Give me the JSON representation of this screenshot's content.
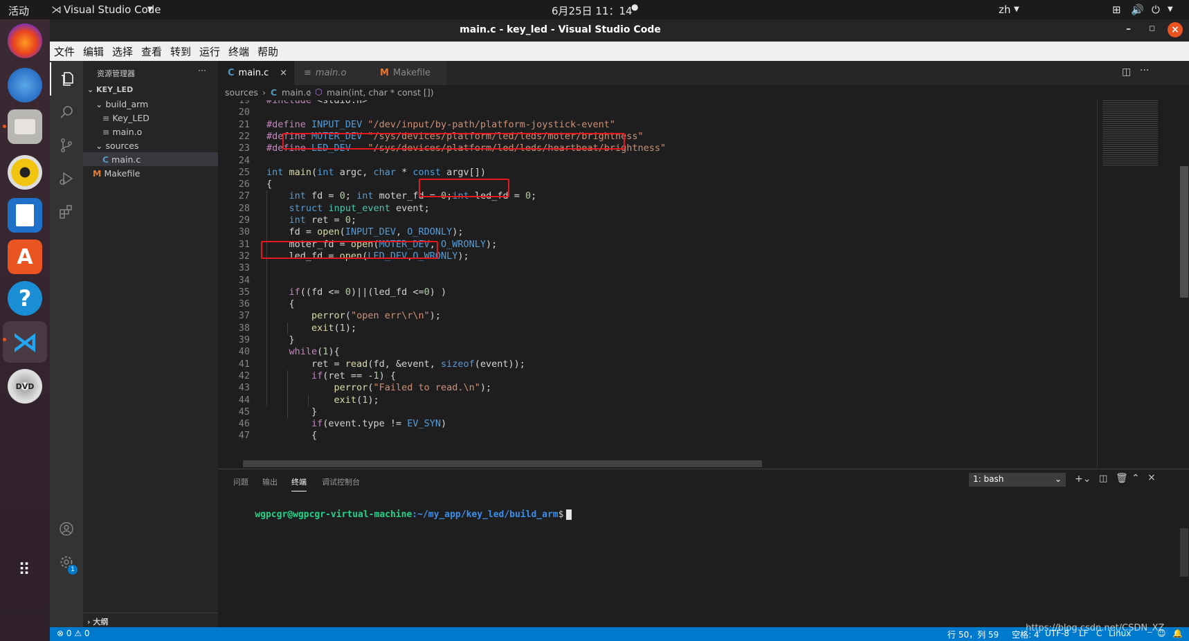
{
  "topbar": {
    "activities": "活动",
    "app_name": "Visual Studio Code",
    "clock": "6月25日  11：14",
    "lang": "zh"
  },
  "window": {
    "title": "main.c - key_led - Visual Studio Code"
  },
  "menu": [
    "文件",
    "编辑",
    "选择",
    "查看",
    "转到",
    "运行",
    "终端",
    "帮助"
  ],
  "sidebar": {
    "header": "资源管理器",
    "more": "···",
    "root": "KEY_LED",
    "items": [
      {
        "label": "build_arm",
        "icon": "v"
      },
      {
        "label": "Key_LED",
        "icon": "≡"
      },
      {
        "label": "main.o",
        "icon": "≡"
      },
      {
        "label": "sources",
        "icon": "v"
      },
      {
        "label": "main.c",
        "icon": "C"
      },
      {
        "label": "Makefile",
        "icon": "M"
      }
    ],
    "outline": "大纲"
  },
  "tabs": [
    {
      "label": "main.c",
      "icon": "C",
      "close": "×"
    },
    {
      "label": "main.o",
      "icon": "≡"
    },
    {
      "label": "Makefile",
      "icon": "M"
    }
  ],
  "breadcrumb": {
    "folder": "sources",
    "file": "main.c",
    "symbol": "main(int, char * const [])"
  },
  "editor": {
    "line_numbers": [
      "19",
      "20",
      "21",
      "22",
      "23",
      "24",
      "25",
      "26",
      "27",
      "28",
      "29",
      "30",
      "31",
      "32",
      "33",
      "34",
      "35",
      "36",
      "37",
      "38",
      "39",
      "40",
      "41",
      "42",
      "43",
      "44",
      "45",
      "46",
      "47"
    ],
    "lines": [
      "#include <stdio.h>",
      "",
      "#define INPUT_DEV \"/dev/input/by-path/platform-joystick-event\"",
      "#define MOTER_DEV \"/sys/devices/platform/led/leds/moter/brightness\"",
      "#define LED_DEV   \"/sys/devices/platform/led/leds/heartbeat/brightness\"",
      "",
      "int main(int argc, char * const argv[])",
      "{",
      "    int fd = 0; int moter_fd = 0;int led_fd = 0;",
      "    struct input_event event;",
      "    int ret = 0;",
      "    fd = open(INPUT_DEV, O_RDONLY);",
      "    moter_fd = open(MOTER_DEV, O_WRONLY);",
      "    led_fd = open(LED_DEV,O_WRONLY);",
      "",
      "",
      "    if((fd <= 0)||(led_fd <=0) )",
      "    {",
      "        perror(\"open err\\r\\n\");",
      "        exit(1);",
      "    }",
      "    while(1){",
      "        ret = read(fd, &event, sizeof(event));",
      "        if(ret == -1) {",
      "            perror(\"Failed to read.\\n\");",
      "            exit(1);",
      "        }",
      "        if(event.type != EV_SYN)",
      "        {"
    ]
  },
  "panel": {
    "tabs": [
      "问题",
      "输出",
      "终端",
      "调试控制台"
    ],
    "active_tab": "终端",
    "terminal_select": "1: bash",
    "prompt_user": "wgpcgr@wgpcgr-virtual-machine",
    "prompt_path": ":~/my_app/key_led/build_arm",
    "prompt_sign": "$"
  },
  "status": {
    "errors": "⊗ 0 ⚠ 0",
    "position": "行 50，列 59",
    "spaces": "空格: 4",
    "encoding": "UTF-8",
    "eol": "LF",
    "language": "C",
    "os": "Linux",
    "watermark": "https://blog.csdn.net/CSDN_XZ"
  },
  "colors": {
    "accent": "#007acc",
    "highlight": "#e5171f",
    "ubuntu_orange": "#e95420"
  }
}
